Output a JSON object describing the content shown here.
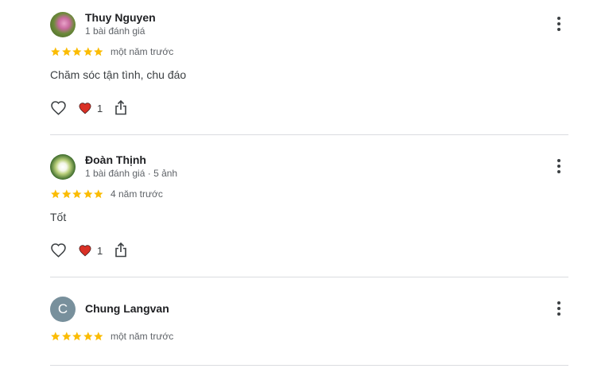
{
  "reviews": [
    {
      "name": "Thuy Nguyen",
      "meta": "1 bài đánh giá",
      "avatar": "photo-pink-flower",
      "rating": 5,
      "date": "một năm trước",
      "text": "Chăm sóc tận tình, chu đáo",
      "likes": "1"
    },
    {
      "name": "Đoàn Thịnh",
      "meta": "1 bài đánh giá · 5 ảnh",
      "avatar": "photo-white-lotus",
      "rating": 5,
      "date": "4 năm trước",
      "text": "Tốt",
      "likes": "1"
    },
    {
      "name": "Chung Langvan",
      "avatar_letter": "C",
      "rating": 5,
      "date": "một năm trước"
    }
  ],
  "colors": {
    "star": "#fbbc04",
    "heart": "#d93025",
    "avatar_letter_bg": "#78909c",
    "divider": "#dadce0"
  },
  "icons": {
    "more": "more-vert-icon",
    "like": "heart-outline-icon",
    "liked": "heart-filled-icon",
    "share": "share-icon",
    "star": "star-icon"
  }
}
